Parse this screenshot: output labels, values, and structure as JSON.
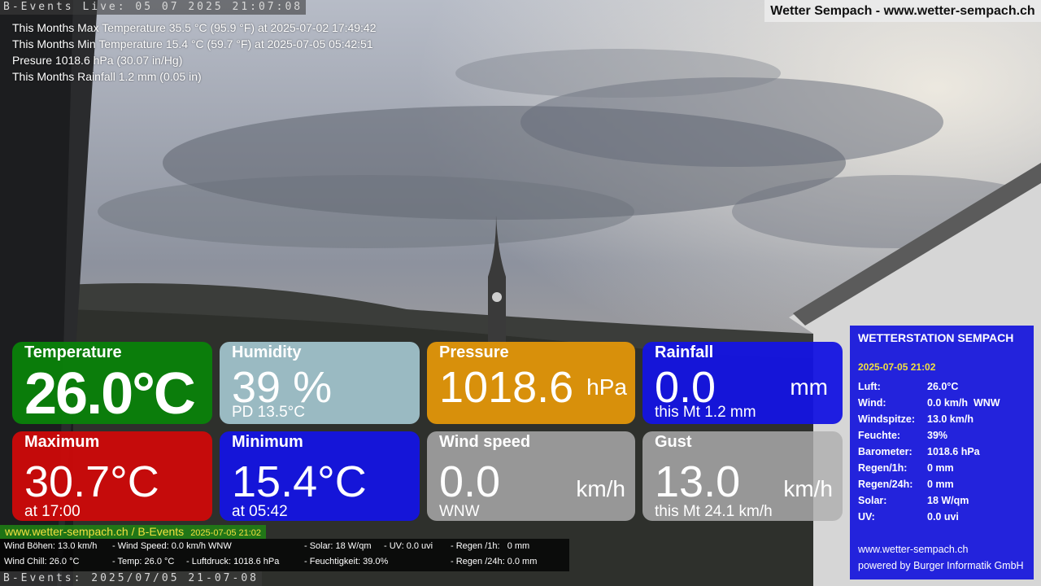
{
  "top_ticker": "B-Events Live: 05 07 2025 21:07:08",
  "bottom_ticker": "B-Events: 2025/07/05 21-07-08",
  "site_banner": "Wetter Sempach - www.wetter-sempach.ch",
  "stats": [
    "This Months Max Temperature 35.5 °C (95.9 °F) at 2025-07-02 17:49:42",
    "This Months Min Temperature 15.4 °C (59.7 °F) at 2025-07-05 05:42:51",
    "Presure 1018.6 hPa (30.07 in/Hg)",
    "This Months Rainfall 1.2 mm (0.05 in)"
  ],
  "tiles": {
    "temperature": {
      "label": "Temperature",
      "value": "26.0°C"
    },
    "humidity": {
      "label": "Humidity",
      "value": "39 %",
      "sub": "PD 13.5°C"
    },
    "pressure": {
      "label": "Pressure",
      "value": "1018.6",
      "unit": "hPa"
    },
    "rainfall": {
      "label": "Rainfall",
      "value": "0.0",
      "unit": "mm",
      "sub": "this Mt 1.2 mm"
    },
    "maximum": {
      "label": "Maximum",
      "value": "30.7°C",
      "sub": "at 17:00"
    },
    "minimum": {
      "label": "Minimum",
      "value": "15.4°C",
      "sub": "at 05:42"
    },
    "windspeed": {
      "label": "Wind speed",
      "value": "0.0",
      "unit": "km/h",
      "sub": "WNW"
    },
    "gust": {
      "label": "Gust",
      "value": "13.0",
      "unit": "km/h",
      "sub": "this Mt 24.1 km/h"
    }
  },
  "station": {
    "title": "WETTERSTATION SEMPACH",
    "date": "2025-07-05 21:02",
    "rows": [
      {
        "k": "Luft:",
        "v": "26.0°C"
      },
      {
        "k": "Wind:",
        "v": "0.0 km/h  WNW"
      },
      {
        "k": "Windspitze:",
        "v": "13.0 km/h"
      },
      {
        "k": "Feuchte:",
        "v": "39%"
      },
      {
        "k": "Barometer:",
        "v": "1018.6 hPa"
      },
      {
        "k": "Regen/1h:",
        "v": "0 mm"
      },
      {
        "k": "Regen/24h:",
        "v": "0 mm"
      },
      {
        "k": "Solar:",
        "v": "18 W/qm"
      },
      {
        "k": "UV:",
        "v": "0.0 uvi"
      }
    ],
    "url": "www.wetter-sempach.ch",
    "credit": "powered by Burger Informatik GmbH"
  },
  "bottom_site": {
    "text": "www.wetter-sempach.ch / B-Events",
    "date": "2025-07-05 21:02"
  },
  "info_bar": {
    "wind_gust": "Wind Böhen: 13.0 km/h",
    "wind_speed": "- Wind Speed: 0.0 km/h WNW",
    "solar": "- Solar: 18 W/qm",
    "uv": "- UV: 0.0 uvi",
    "rain_1h": "- Regen /1h:   0 mm",
    "wind_chill": "Wind Chill: 26.0 °C",
    "temp": "- Temp: 26.0 °C",
    "pressure": "- Luftdruck: 1018.6 hPa",
    "humidity": "- Feuchtigkeit: 39.0%",
    "rain_24h": "- Regen /24h: 0.0 mm"
  }
}
